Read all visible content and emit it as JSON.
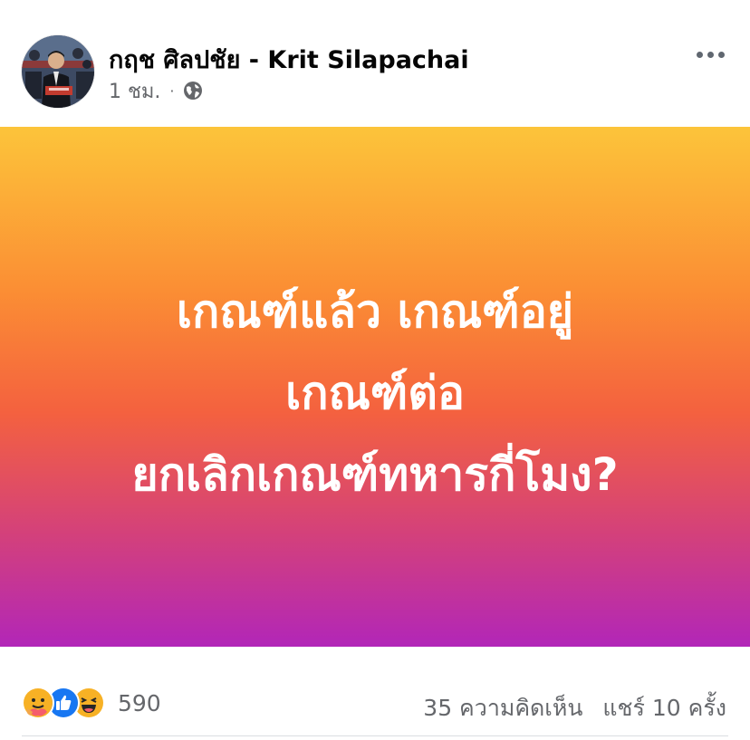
{
  "author": {
    "name": "กฤช ศิลปชัย - Krit Silapachai"
  },
  "post": {
    "time": "1 ชม.",
    "separator": "·",
    "audience_icon": "globe-icon",
    "status_lines": [
      "เกณฑ์แล้ว เกณฑ์อยู่",
      "เกณฑ์ต่อ",
      "ยกเลิกเกณฑ์ทหารกี่โมง?"
    ],
    "background_gradient": [
      "#fcc43a",
      "#fb8d34",
      "#f4613f",
      "#d4417a",
      "#b226b8"
    ]
  },
  "reactions": {
    "icons": [
      "care-icon",
      "like-icon",
      "haha-icon"
    ],
    "count": "590"
  },
  "engagement": {
    "comments": "35 ความคิดเห็น",
    "shares": "แชร์ 10 ครั้ง"
  },
  "colors": {
    "text_primary": "#050505",
    "text_secondary": "#65676b",
    "like_blue": "#1877f2",
    "reaction_yellow": "#f7b125"
  }
}
